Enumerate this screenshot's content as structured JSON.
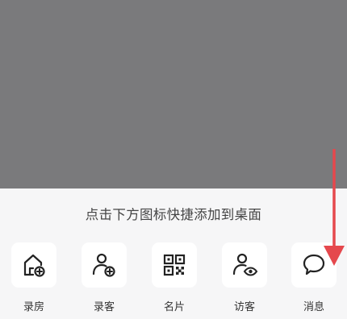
{
  "hint_text": "点击下方图标快捷添加到桌面",
  "shortcuts": [
    {
      "label": "录房",
      "icon": "house-add-icon"
    },
    {
      "label": "录客",
      "icon": "person-add-icon"
    },
    {
      "label": "名片",
      "icon": "qr-code-icon"
    },
    {
      "label": "访客",
      "icon": "person-view-icon"
    },
    {
      "label": "消息",
      "icon": "chat-bubble-icon"
    }
  ],
  "colors": {
    "overlay": "#7a7a7c",
    "sheet": "#f6f6f7",
    "arrow": "#e5484d"
  }
}
